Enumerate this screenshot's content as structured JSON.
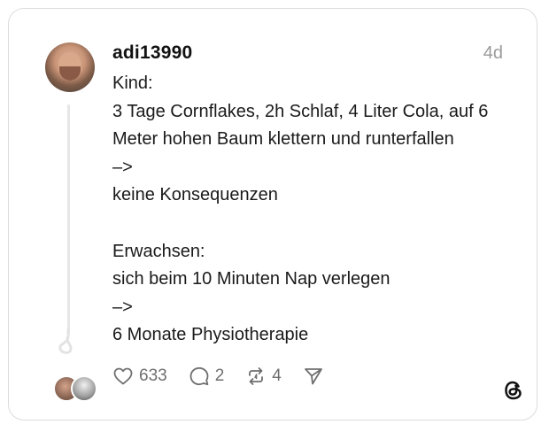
{
  "post": {
    "username": "adi13990",
    "time": "4d",
    "lines": [
      "Kind:",
      "3 Tage Cornflakes, 2h Schlaf, 4 Liter Cola, auf 6",
      "Meter hohen Baum klettern und runterfallen",
      "–>",
      "keine Konsequenzen",
      "",
      "Erwachsen:",
      "sich beim 10 Minuten Nap verlegen",
      "–>",
      "6 Monate Physiotherapie"
    ]
  },
  "actions": {
    "likes": "633",
    "replies": "2",
    "reposts": "4"
  },
  "icons": {
    "like": "heart-icon",
    "reply": "speech-bubble-icon",
    "repost": "repost-arrows-icon",
    "share": "send-icon",
    "brand": "threads-logo-icon"
  },
  "colors": {
    "text": "#111111",
    "muted": "#9a9a9a",
    "icon": "#6f6f6f",
    "border": "#dcdcdc"
  }
}
